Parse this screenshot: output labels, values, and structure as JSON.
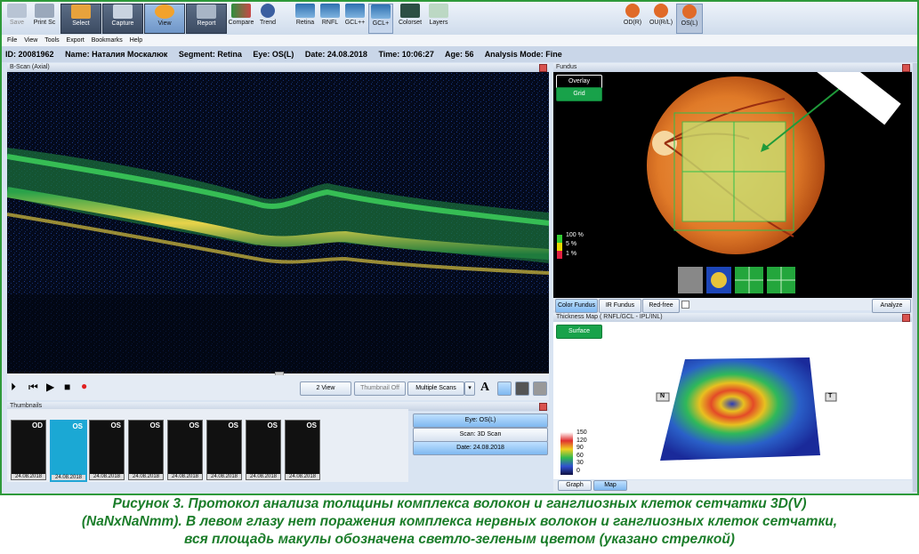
{
  "toolbar": {
    "save": "Save",
    "print": "Print Sc",
    "select": "Select",
    "capture": "Capture",
    "view": "View",
    "report": "Report",
    "compare": "Compare",
    "trend": "Trend",
    "retina": "Retina",
    "rnfl": "RNFL",
    "gclpp": "GCL++",
    "gclp": "GCL+",
    "colorset": "Colorset",
    "layers": "Layers",
    "eye_od": "OD(R)",
    "eye_ou": "OU(R/L)",
    "eye_os": "OS(L)"
  },
  "menu": [
    "File",
    "View",
    "Tools",
    "Export",
    "Bookmarks",
    "Help"
  ],
  "patient": {
    "id": "ID: 20081962",
    "name": "Name: Наталия Москалюк",
    "segment": "Segment: Retina",
    "eye": "Eye: OS(L)",
    "date": "Date: 24.08.2018",
    "time": "Time: 10:06:27",
    "age": "Age: 56",
    "mode": "Analysis Mode: Fine"
  },
  "bscan": {
    "title": "B-Scan (Axial)"
  },
  "controls": {
    "two_view": "2 View",
    "thumbnail_off": "Thumbnail Off",
    "multiple_scans": "Multiple Scans",
    "font_letter": "A"
  },
  "thumbnails": {
    "title": "Thumbnails",
    "items": [
      {
        "eye": "OD",
        "date": "24.08.2018"
      },
      {
        "eye": "OS",
        "date": "24.08.2018"
      },
      {
        "eye": "OS",
        "date": "24.08.2018"
      },
      {
        "eye": "OS",
        "date": "24.08.2018"
      },
      {
        "eye": "OS",
        "date": "24.08.2018"
      },
      {
        "eye": "OS",
        "date": "24.08.2018"
      },
      {
        "eye": "OS",
        "date": "24.08.2018"
      },
      {
        "eye": "OS",
        "date": "24.08.2018"
      }
    ],
    "filter_eye": "Eye: OS(L)",
    "filter_scan": "Scan: 3D Scan",
    "filter_date": "Date: 24.08.2018"
  },
  "fundus": {
    "title": "Fundus",
    "overlay": "Overlay",
    "grid": "Grid",
    "legend": [
      "100 %",
      "5 %",
      "1 %"
    ],
    "buttons": [
      "Color Fundus",
      "IR Fundus",
      "Red-free"
    ],
    "analyze": "Analyze"
  },
  "thickness": {
    "title": "Thickness Map  ( RNFL/GCL - IPL/INL)",
    "surface": "Surface",
    "scale": [
      "150",
      "120",
      "90",
      "60",
      "30",
      "0"
    ],
    "left_marker": "N",
    "right_marker": "T",
    "graph_btn": "Graph",
    "map_btn": "Map"
  },
  "caption": {
    "line1": "Рисунок 3. Протокол анализа толщины комплекса волокон и ганглиозных клеток сетчатки 3D(V)",
    "line2": "(NaNxNaNmm). В левом глазу нет поражения комплекса нервных волокон и ганглиозных клеток сетчатки,",
    "line3": "вся площадь макулы обозначена светло-зеленым цветом (указано стрелкой)"
  }
}
